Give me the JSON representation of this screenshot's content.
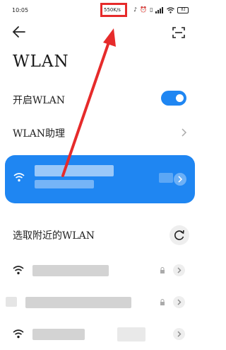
{
  "status_bar": {
    "time": "10:05",
    "net_speed": "550K/s",
    "battery": "82"
  },
  "header": {
    "title": "WLAN"
  },
  "settings": {
    "enable_label": "开启WLAN",
    "enable_on": true,
    "assistant_label": "WLAN助理"
  },
  "nearby": {
    "title": "选取附近的WLAN"
  },
  "colors": {
    "accent": "#1f86f2",
    "annotation": "#e62b2b"
  },
  "icons": {
    "back": "back-arrow-icon",
    "scan": "scan-icon",
    "wifi": "wifi-icon",
    "lock": "lock-icon",
    "refresh": "refresh-icon",
    "chevron": "chevron-right-icon"
  }
}
